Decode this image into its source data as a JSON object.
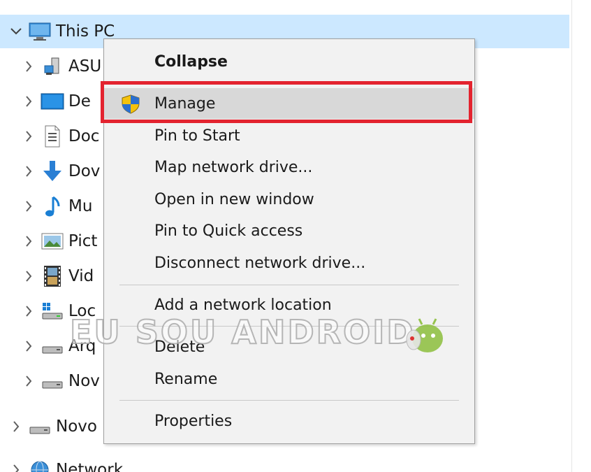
{
  "tree": {
    "this_pc": {
      "label": "This PC",
      "icon": "computer-icon",
      "expanded": true
    },
    "children": [
      {
        "label": "ASU",
        "icon": "pc-icon"
      },
      {
        "label": "De",
        "icon": "desktop-icon"
      },
      {
        "label": "Doc",
        "icon": "documents-icon"
      },
      {
        "label": "Dov",
        "icon": "downloads-icon"
      },
      {
        "label": "Mu",
        "icon": "music-icon"
      },
      {
        "label": "Pict",
        "icon": "pictures-icon"
      },
      {
        "label": "Vid",
        "icon": "videos-icon"
      },
      {
        "label": "Loc",
        "icon": "local-disk-icon"
      },
      {
        "label": "Arq",
        "icon": "drive-icon"
      },
      {
        "label": "Nov",
        "icon": "drive-icon"
      }
    ],
    "root_items": [
      {
        "label": "Novo",
        "icon": "drive-icon"
      },
      {
        "label": "Network",
        "icon": "network-icon"
      }
    ]
  },
  "context_menu": {
    "items": [
      {
        "label": "Collapse",
        "bold": true
      },
      {
        "label": "Manage",
        "icon": "shield-icon",
        "highlighted": true
      },
      {
        "label": "Pin to Start"
      },
      {
        "label": "Map network drive..."
      },
      {
        "label": "Open in new window"
      },
      {
        "label": "Pin to Quick access"
      },
      {
        "label": "Disconnect network drive..."
      },
      {
        "label": "Add a network location"
      },
      {
        "label": "Delete"
      },
      {
        "label": "Rename"
      },
      {
        "label": "Properties"
      }
    ]
  },
  "watermark": {
    "text": "EU SOU ANDROID",
    "logo": "android-mascot-icon"
  },
  "colors": {
    "selection": "#cce8ff",
    "menu_bg": "#f2f2f2",
    "menu_hot": "#d8d8d8",
    "annotation_red": "#e3232f"
  }
}
